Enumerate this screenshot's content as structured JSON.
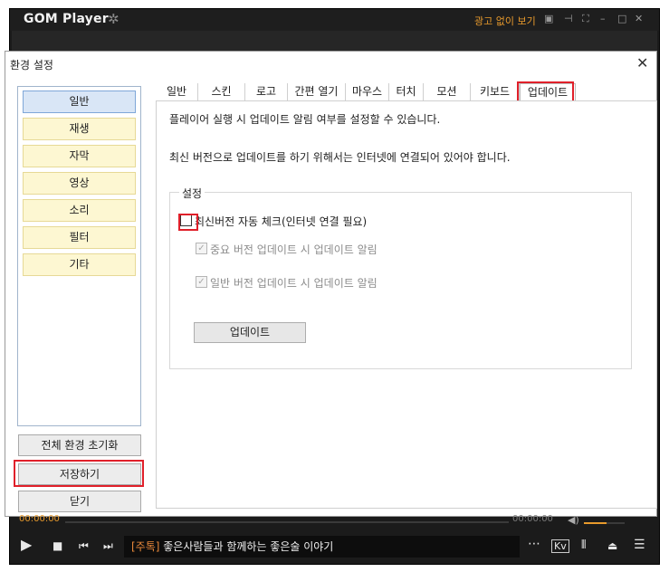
{
  "player": {
    "logo": "GOM Player",
    "ad_free_link": "광고 없이 보기",
    "time_current": "00:00:00",
    "time_total": "00:00:00",
    "volume_level": 0.55,
    "ticker_tag": "[주톡]",
    "ticker_text": " 좋은사람들과 함께하는 좋은술 이야기"
  },
  "dialog": {
    "title": "환경 설정",
    "nav": [
      "일반",
      "재생",
      "자막",
      "영상",
      "소리",
      "필터",
      "기타"
    ],
    "nav_active_index": 0,
    "reset_label": "전체 환경 초기화",
    "save_label": "저장하기",
    "close_label": "닫기",
    "tabs": [
      "일반",
      "스킨",
      "로고",
      "간편 열기",
      "마우스",
      "터치",
      "모션",
      "키보드",
      "업데이트"
    ],
    "active_tab_index": 8,
    "content": {
      "line1": "플레이어 실행 시 업데이트 알림 여부를 설정할 수 있습니다.",
      "line2": "최신 버전으로 업데이트를 하기 위해서는 인터넷에 연결되어 있어야 합니다.",
      "group_label": "설정",
      "auto_check_label": "최신버전 자동 체크(인터넷 연결 필요)",
      "auto_check_checked": false,
      "important_label": "중요 버전 업데이트 시 업데이트 알림",
      "important_checked": true,
      "normal_label": "일반 버전 업데이트 시 업데이트 알림",
      "normal_checked": true,
      "update_button": "업데이트"
    }
  },
  "highlight_color": "#e0202a",
  "accent_color": "#e89a2c"
}
